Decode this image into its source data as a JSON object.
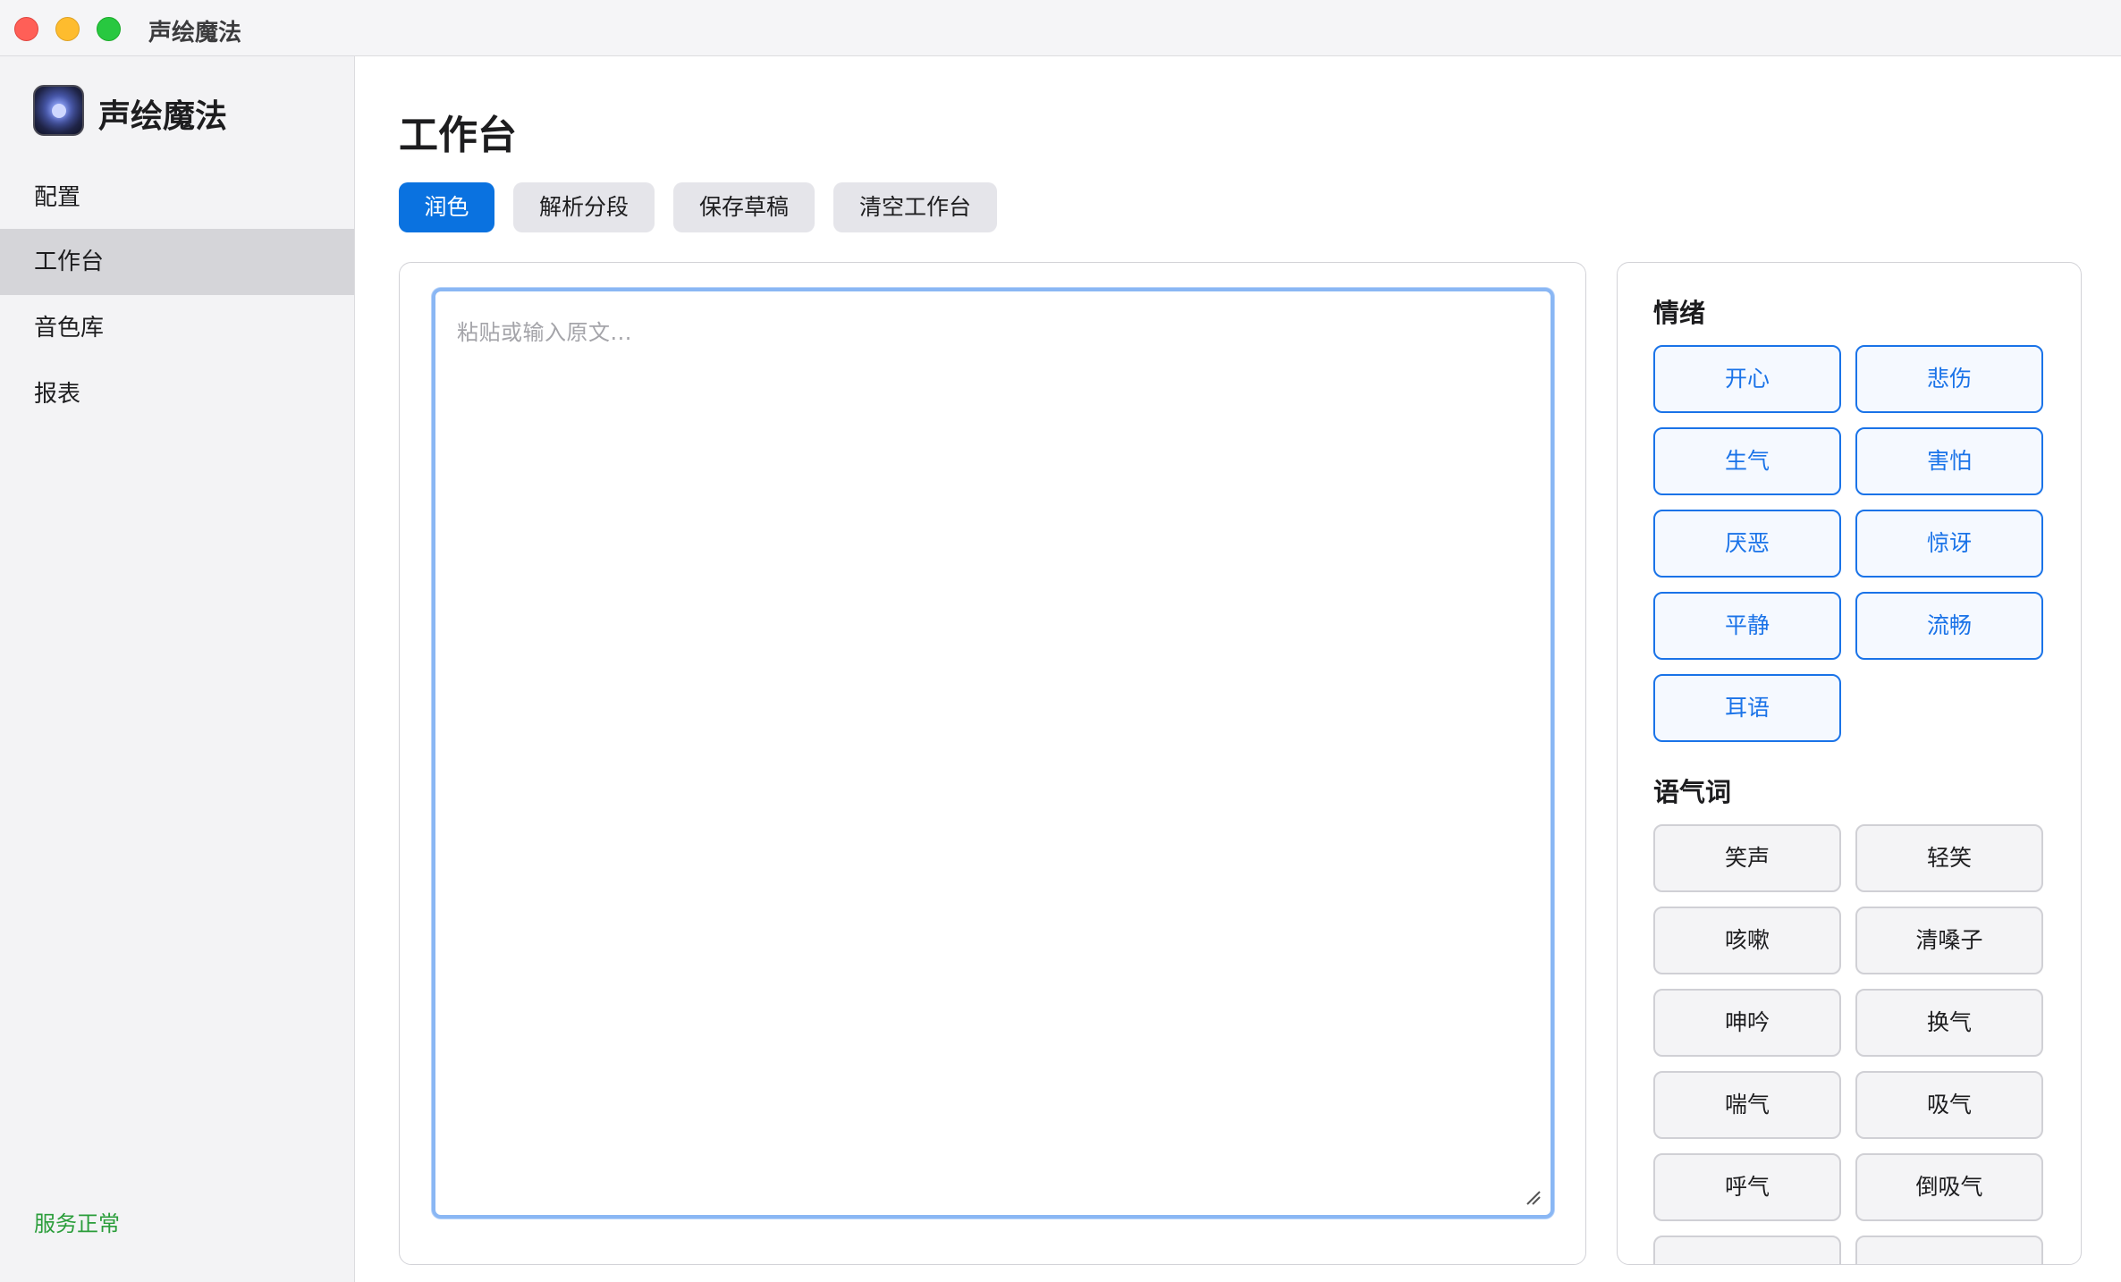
{
  "window": {
    "title": "声绘魔法",
    "controls": [
      "close",
      "minimize",
      "maximize"
    ]
  },
  "sidebar": {
    "app_name": "声绘魔法",
    "logo_icon": "app-logo-icon",
    "items": [
      {
        "label": "配置",
        "active": false
      },
      {
        "label": "工作台",
        "active": true
      },
      {
        "label": "音色库",
        "active": false
      },
      {
        "label": "报表",
        "active": false
      }
    ],
    "status": "服务正常",
    "status_color": "#2a9d3a"
  },
  "main": {
    "title": "工作台",
    "toolbar": {
      "polish_label": "润色",
      "parse_label": "解析分段",
      "save_draft_label": "保存草稿",
      "clear_label": "清空工作台"
    },
    "editor": {
      "placeholder": "粘贴或输入原文...",
      "value": ""
    },
    "tags": {
      "emotion_title": "情绪",
      "emotions": [
        "开心",
        "悲伤",
        "生气",
        "害怕",
        "厌恶",
        "惊讶",
        "平静",
        "流畅",
        "耳语"
      ],
      "tone_title": "语气词",
      "tones": [
        "笑声",
        "轻笑",
        "咳嗽",
        "清嗓子",
        "呻吟",
        "换气",
        "喘气",
        "吸气",
        "呼气",
        "倒吸气"
      ]
    }
  },
  "colors": {
    "accent": "#0a72e0",
    "emotion_chip": "#1a73e8"
  }
}
